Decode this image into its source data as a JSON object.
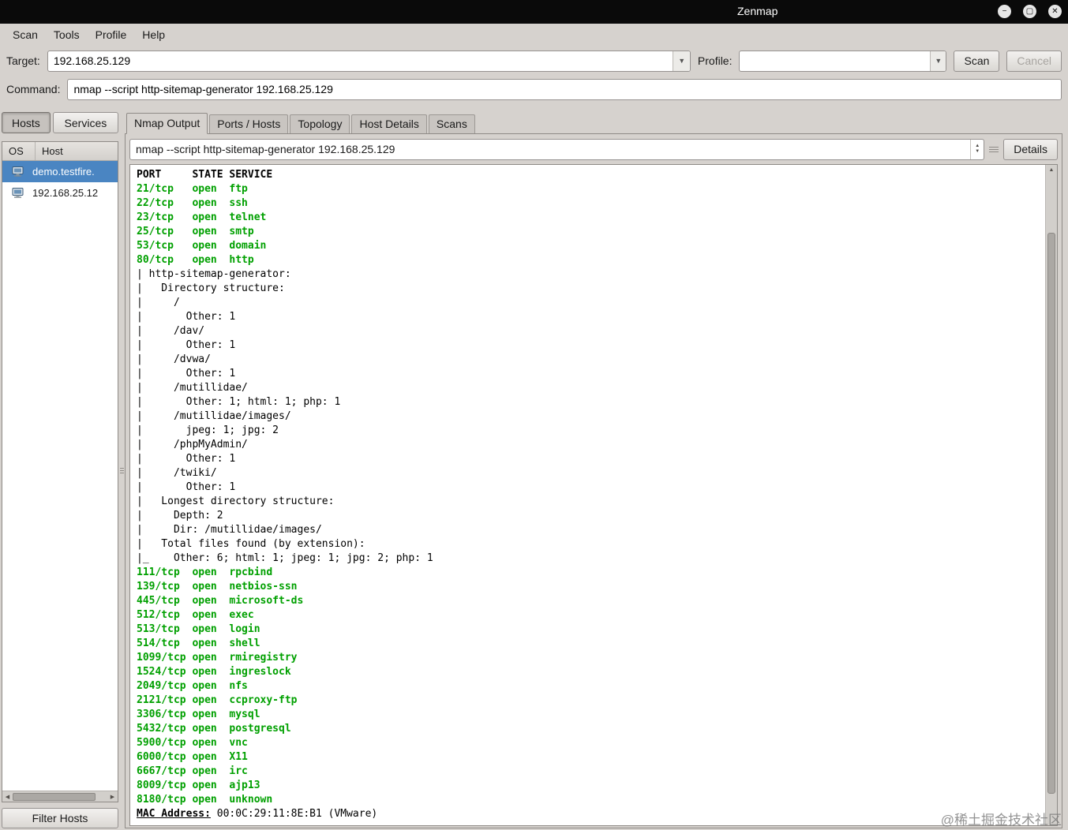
{
  "window": {
    "title": "Zenmap",
    "controls": [
      {
        "name": "minimize",
        "glyph": "−"
      },
      {
        "name": "maximize",
        "glyph": "▢"
      },
      {
        "name": "close",
        "glyph": "✕"
      }
    ]
  },
  "menu": {
    "items": [
      "Scan",
      "Tools",
      "Profile",
      "Help"
    ]
  },
  "scan_bar": {
    "target_label": "Target:",
    "target_value": "192.168.25.129",
    "profile_label": "Profile:",
    "profile_value": "",
    "scan_label": "Scan",
    "cancel_label": "Cancel"
  },
  "command_bar": {
    "label": "Command:",
    "value": "nmap --script http-sitemap-generator 192.168.25.129"
  },
  "hosts_panel": {
    "hosts_button": "Hosts",
    "services_button": "Services",
    "os_header": "OS",
    "host_header": "Host",
    "hosts": [
      {
        "name": "demo.testfire.",
        "selected": true
      },
      {
        "name": "192.168.25.12",
        "selected": false
      }
    ],
    "filter_button": "Filter Hosts"
  },
  "notebook": {
    "tabs": [
      {
        "label": "Nmap Output",
        "active": true
      },
      {
        "label": "Ports / Hosts",
        "active": false
      },
      {
        "label": "Topology",
        "active": false
      },
      {
        "label": "Host Details",
        "active": false
      },
      {
        "label": "Scans",
        "active": false
      }
    ]
  },
  "output_toolbar": {
    "command": "nmap --script http-sitemap-generator 192.168.25.129",
    "details_label": "Details"
  },
  "nmap_output": {
    "lines": [
      {
        "style": "header",
        "text": "PORT     STATE SERVICE"
      },
      {
        "style": "open",
        "text": "21/tcp   open  ftp"
      },
      {
        "style": "open",
        "text": "22/tcp   open  ssh"
      },
      {
        "style": "open",
        "text": "23/tcp   open  telnet"
      },
      {
        "style": "open",
        "text": "25/tcp   open  smtp"
      },
      {
        "style": "open",
        "text": "53/tcp   open  domain"
      },
      {
        "style": "open",
        "text": "80/tcp   open  http"
      },
      {
        "style": "plain",
        "text": "| http-sitemap-generator:"
      },
      {
        "style": "plain",
        "text": "|   Directory structure:"
      },
      {
        "style": "plain",
        "text": "|     /"
      },
      {
        "style": "plain",
        "text": "|       Other: 1"
      },
      {
        "style": "plain",
        "text": "|     /dav/"
      },
      {
        "style": "plain",
        "text": "|       Other: 1"
      },
      {
        "style": "plain",
        "text": "|     /dvwa/"
      },
      {
        "style": "plain",
        "text": "|       Other: 1"
      },
      {
        "style": "plain",
        "text": "|     /mutillidae/"
      },
      {
        "style": "plain",
        "text": "|       Other: 1; html: 1; php: 1"
      },
      {
        "style": "plain",
        "text": "|     /mutillidae/images/"
      },
      {
        "style": "plain",
        "text": "|       jpeg: 1; jpg: 2"
      },
      {
        "style": "plain",
        "text": "|     /phpMyAdmin/"
      },
      {
        "style": "plain",
        "text": "|       Other: 1"
      },
      {
        "style": "plain",
        "text": "|     /twiki/"
      },
      {
        "style": "plain",
        "text": "|       Other: 1"
      },
      {
        "style": "plain",
        "text": "|   Longest directory structure:"
      },
      {
        "style": "plain",
        "text": "|     Depth: 2"
      },
      {
        "style": "plain",
        "text": "|     Dir: /mutillidae/images/"
      },
      {
        "style": "plain",
        "text": "|   Total files found (by extension):"
      },
      {
        "style": "plain",
        "text": "|_    Other: 6; html: 1; jpeg: 1; jpg: 2; php: 1"
      },
      {
        "style": "open",
        "text": "111/tcp  open  rpcbind"
      },
      {
        "style": "open",
        "text": "139/tcp  open  netbios-ssn"
      },
      {
        "style": "open",
        "text": "445/tcp  open  microsoft-ds"
      },
      {
        "style": "open",
        "text": "512/tcp  open  exec"
      },
      {
        "style": "open",
        "text": "513/tcp  open  login"
      },
      {
        "style": "open",
        "text": "514/tcp  open  shell"
      },
      {
        "style": "open",
        "text": "1099/tcp open  rmiregistry"
      },
      {
        "style": "open",
        "text": "1524/tcp open  ingreslock"
      },
      {
        "style": "open",
        "text": "2049/tcp open  nfs"
      },
      {
        "style": "open",
        "text": "2121/tcp open  ccproxy-ftp"
      },
      {
        "style": "open",
        "text": "3306/tcp open  mysql"
      },
      {
        "style": "open",
        "text": "5432/tcp open  postgresql"
      },
      {
        "style": "open",
        "text": "5900/tcp open  vnc"
      },
      {
        "style": "open",
        "text": "6000/tcp open  X11"
      },
      {
        "style": "open",
        "text": "6667/tcp open  irc"
      },
      {
        "style": "open",
        "text": "8009/tcp open  ajp13"
      },
      {
        "style": "open",
        "text": "8180/tcp open  unknown"
      },
      {
        "style": "mac",
        "label": "MAC Address:",
        "text": " 00:0C:29:11:8E:B1 (VMware)"
      }
    ]
  },
  "icons": {
    "dropdown_arrow": "▼",
    "spinner_up": "▲",
    "spinner_down": "▼",
    "scrollbar_up_arrow": "▲",
    "scrollbar_left_arrow": "◀",
    "scrollbar_right_arrow": "▶"
  },
  "watermark": "@稀土掘金技术社区",
  "colors": {
    "titlebar_black": "#0a0a0a",
    "open_port_green": "#00a000",
    "selected_host_blue": "#4a85c2"
  }
}
